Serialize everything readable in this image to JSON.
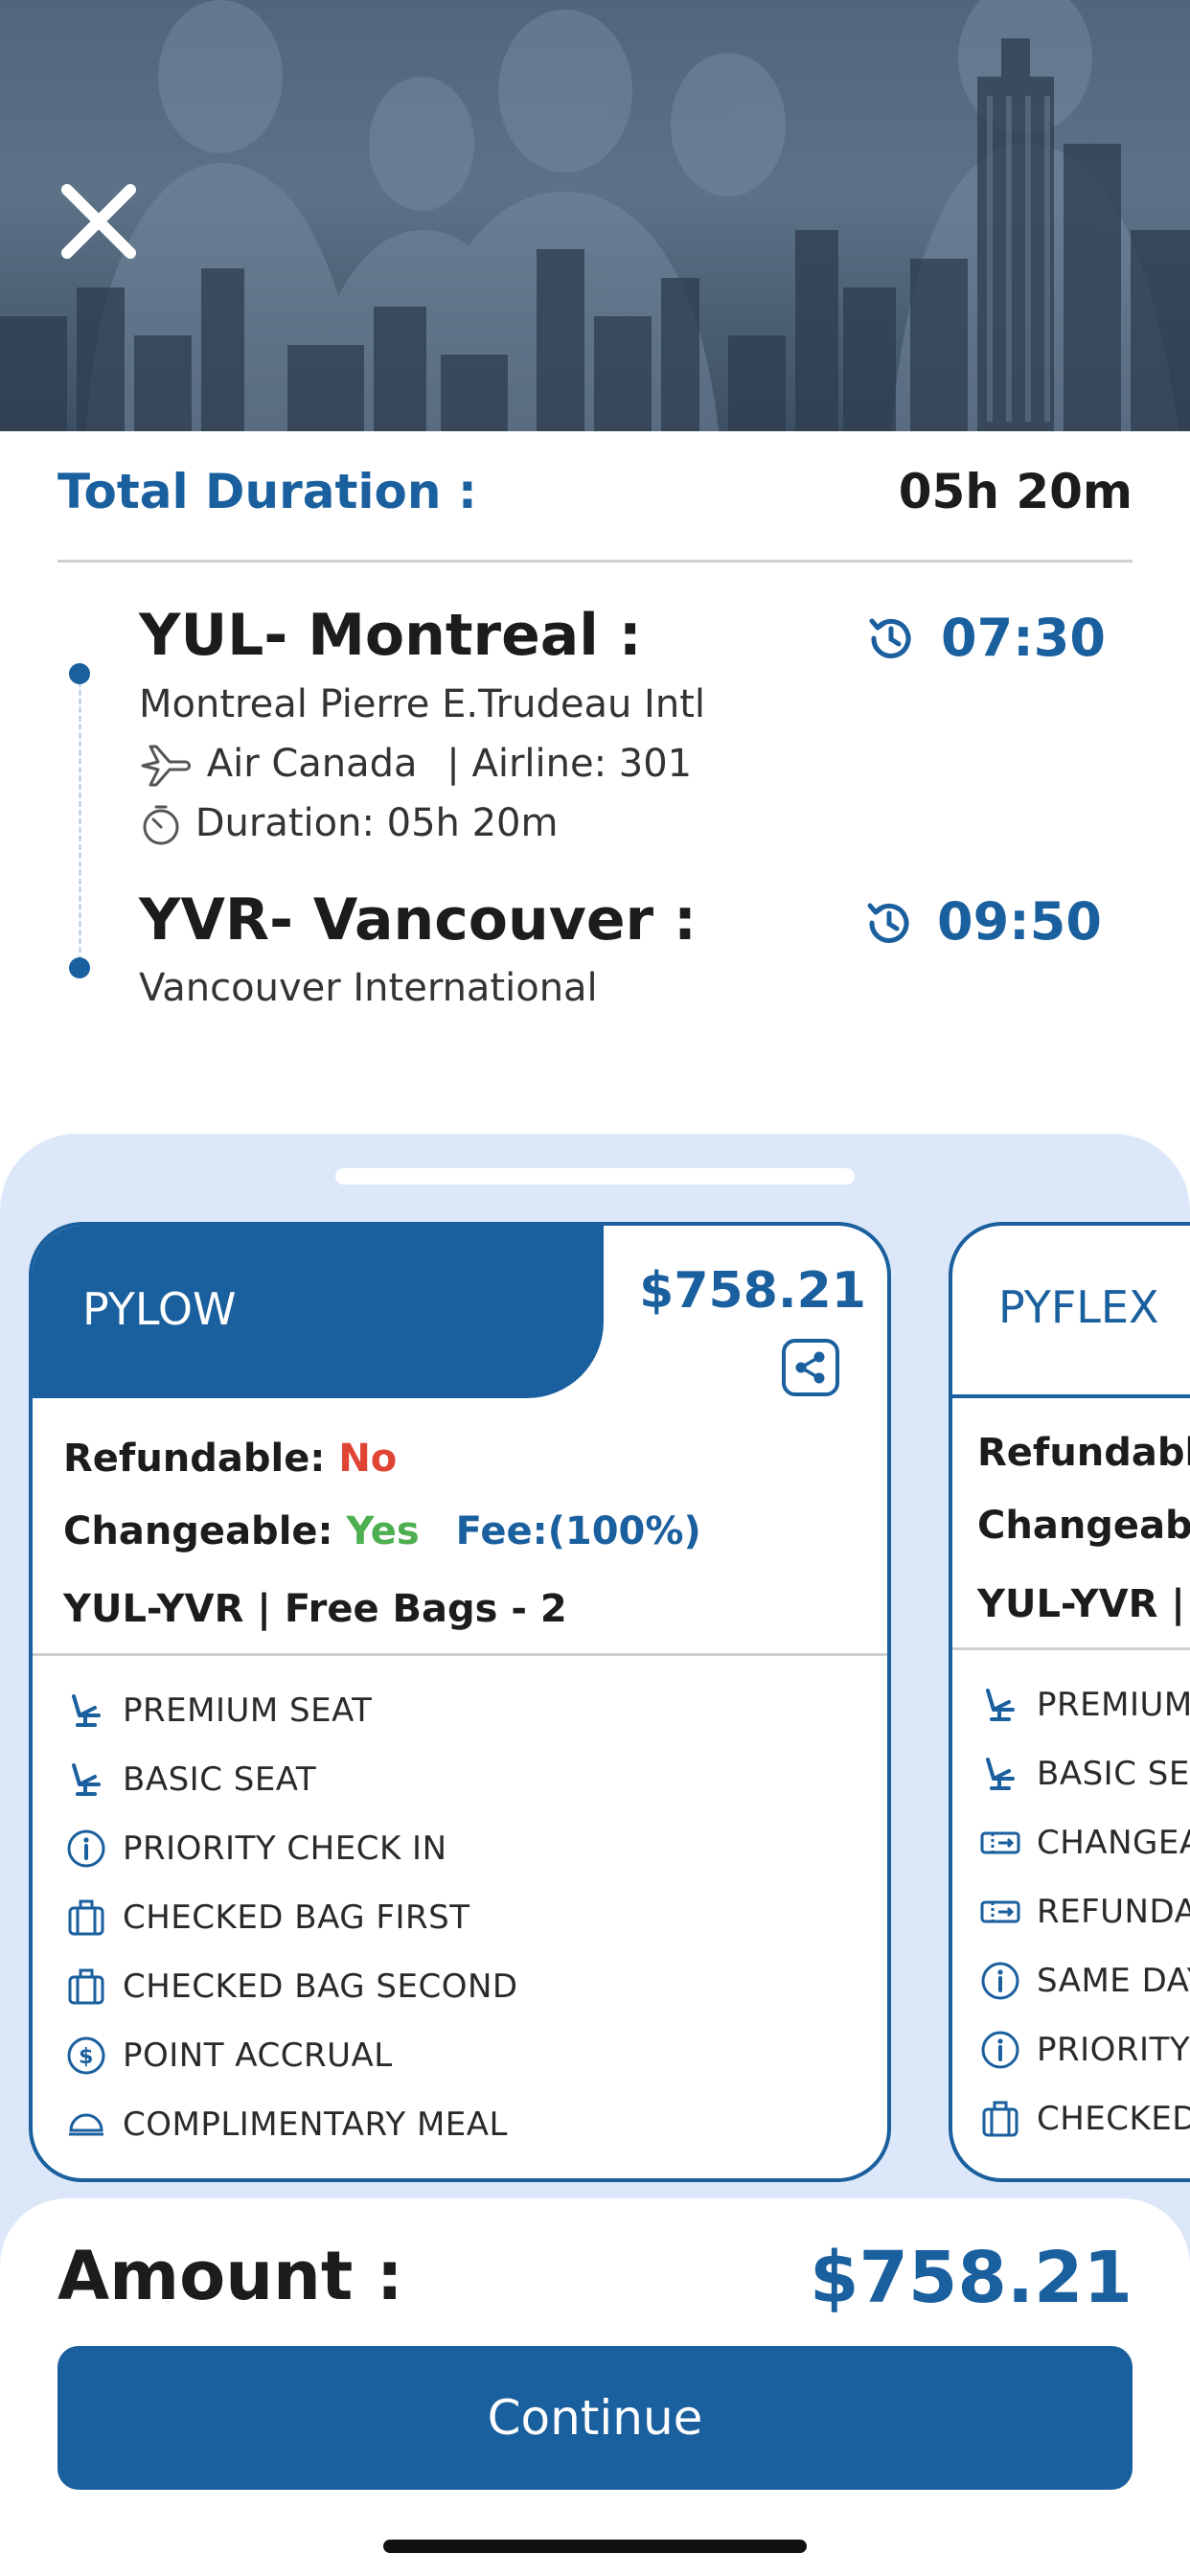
{
  "header": {
    "close_icon": "close-icon"
  },
  "duration": {
    "label": "Total Duration :",
    "value": "05h 20m"
  },
  "origin": {
    "title": "YUL- Montreal :",
    "time": "07:30",
    "airport": "Montreal Pierre E.Trudeau Intl",
    "airline": "Air Canada",
    "flight": "| Airline: 301",
    "duration": "Duration: 05h 20m"
  },
  "destination": {
    "title": "YVR- Vancouver :",
    "time": "09:50",
    "airport": "Vancouver International"
  },
  "fares": [
    {
      "name": "PYLOW",
      "price": "$758.21",
      "refundable_label": "Refundable:",
      "refundable_value": "No",
      "changeable_label": "Changeable:",
      "changeable_value": "Yes",
      "fee": "Fee:(100%)",
      "bags": "YUL-YVR | Free Bags - 2",
      "features": [
        {
          "icon": "seat-icon",
          "label": "PREMIUM SEAT"
        },
        {
          "icon": "seat-icon",
          "label": "BASIC SEAT"
        },
        {
          "icon": "info-icon",
          "label": "PRIORITY CHECK IN"
        },
        {
          "icon": "luggage-icon",
          "label": "CHECKED BAG FIRST"
        },
        {
          "icon": "luggage-icon",
          "label": "CHECKED BAG SECOND"
        },
        {
          "icon": "dollar-icon",
          "label": "POINT ACCRUAL"
        },
        {
          "icon": "meal-icon",
          "label": "COMPLIMENTARY MEAL"
        }
      ]
    },
    {
      "name": "PYFLEX",
      "refundable_label": "Refundable",
      "changeable_label": "Changeab",
      "bags": "YUL-YVR | F",
      "features": [
        {
          "icon": "seat-icon",
          "label": "PREMIUM S"
        },
        {
          "icon": "seat-icon",
          "label": "BASIC SEA"
        },
        {
          "icon": "ticket-icon",
          "label": "CHANGEA"
        },
        {
          "icon": "ticket-icon",
          "label": "REFUNDAE"
        },
        {
          "icon": "info-icon",
          "label": "SAME DAY"
        },
        {
          "icon": "info-icon",
          "label": "PRIORITY C"
        },
        {
          "icon": "luggage-icon",
          "label": "CHECKED"
        }
      ]
    }
  ],
  "footer": {
    "amount_label": "Amount :",
    "amount_value": "$758.21",
    "continue_label": "Continue"
  },
  "colors": {
    "brand": "#1a5f9e",
    "sheet": "#dce8f9",
    "no": "#e04434",
    "yes": "#4caf50"
  }
}
